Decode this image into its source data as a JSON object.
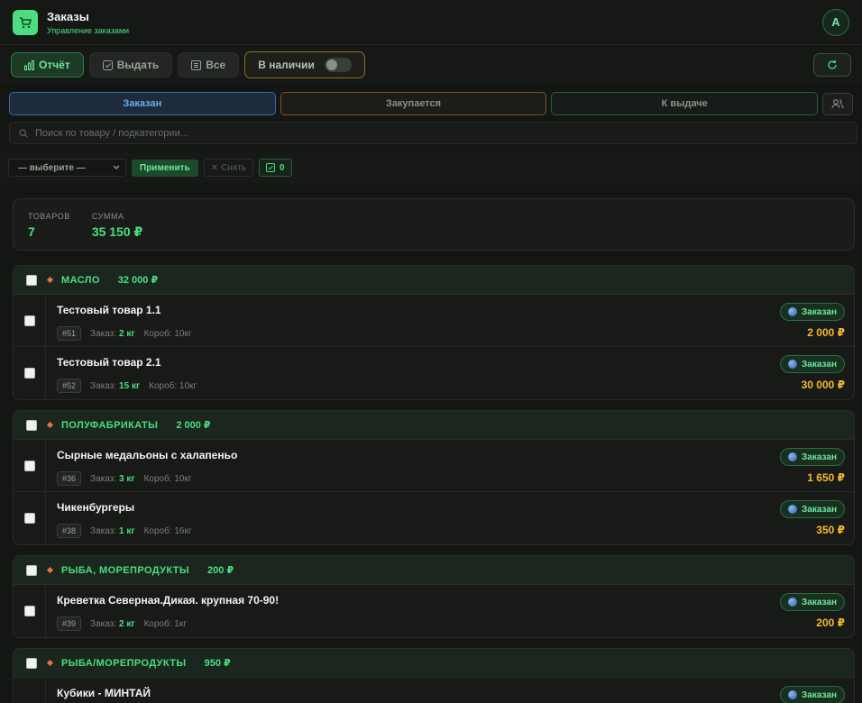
{
  "header": {
    "title": "Заказы",
    "subtitle": "Управление заказами",
    "avatar": "A"
  },
  "toolbar": {
    "report": "Отчёт",
    "issue": "Выдать",
    "all": "Все",
    "in_stock": "В наличии"
  },
  "status_tabs": [
    "Заказан",
    "Закупается",
    "К выдаче"
  ],
  "search": {
    "placeholder": "Поиск по товару / подкатегории..."
  },
  "bulk": {
    "select_value": "— выберите —",
    "apply": "Применить",
    "unset": "Снять",
    "selected_count": "0"
  },
  "summary": {
    "items_label": "ТОВАРОВ",
    "items_value": "7",
    "sum_label": "СУММА",
    "sum_value": "35 150 ₽"
  },
  "groups": [
    {
      "name": "МАСЛО",
      "total": "32 000 ₽",
      "items": [
        {
          "name": "Тестовый товар 1.1",
          "id": "#51",
          "order_label": "Заказ:",
          "qty": "2 кг",
          "box": "Короб: 10кг",
          "status": "Заказан",
          "price": "2 000 ₽"
        },
        {
          "name": "Тестовый товар 2.1",
          "id": "#52",
          "order_label": "Заказ:",
          "qty": "15 кг",
          "box": "Короб: 10кг",
          "status": "Заказан",
          "price": "30 000 ₽"
        }
      ]
    },
    {
      "name": "ПОЛУФАБРИКАТЫ",
      "total": "2 000 ₽",
      "items": [
        {
          "name": "Сырные медальоны с халапеньо",
          "id": "#36",
          "order_label": "Заказ:",
          "qty": "3 кг",
          "box": "Короб: 10кг",
          "status": "Заказан",
          "price": "1 650 ₽"
        },
        {
          "name": "Чикенбургеры",
          "id": "#38",
          "order_label": "Заказ:",
          "qty": "1 кг",
          "box": "Короб: 16кг",
          "status": "Заказан",
          "price": "350 ₽"
        }
      ]
    },
    {
      "name": "РЫБА, МОРЕПРОДУКТЫ",
      "total": "200 ₽",
      "items": [
        {
          "name": "Креветка Северная.Дикая. крупная 70-90!",
          "id": "#39",
          "order_label": "Заказ:",
          "qty": "2 кг",
          "box": "Короб: 1кг",
          "status": "Заказан",
          "price": "200 ₽"
        }
      ]
    },
    {
      "name": "РЫБА/МОРЕПРОДУКТЫ",
      "total": "950 ₽",
      "items": [
        {
          "name": "Кубики - МИНТАЙ",
          "status": "Заказан"
        }
      ]
    }
  ]
}
